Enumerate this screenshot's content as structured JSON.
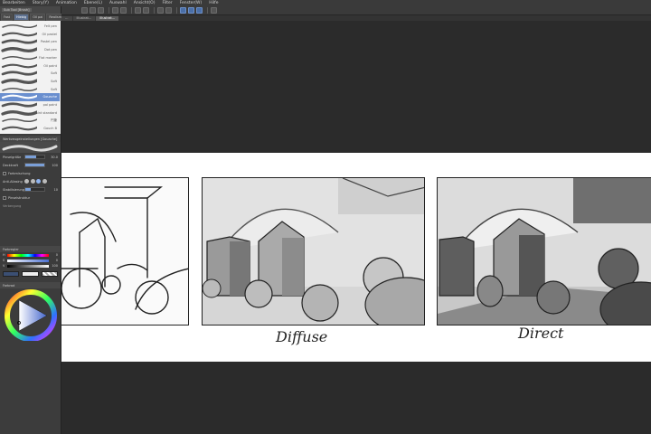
{
  "menu": [
    "Bearbeiten",
    "Story(Y)",
    "Animation",
    "Ebene(L)",
    "Auswahl",
    "Ansicht(O)",
    "Filter",
    "Fenster(W)",
    "Hilfe"
  ],
  "tabs": [
    {
      "label": "…",
      "active": false
    },
    {
      "label": "Illustrat…",
      "active": false
    },
    {
      "label": "Illustrat…",
      "active": true
    }
  ],
  "left_panel": {
    "sub_tool_tab": "Sub Tool [Brush]",
    "tool_tabs": [
      "Fast",
      "Hiebig",
      "Oil pai",
      "Realism",
      "Gouac"
    ],
    "brushes": [
      {
        "label": "Felt pen",
        "active": false
      },
      {
        "label": "Oil pastel",
        "active": false
      },
      {
        "label": "Pastel pen",
        "active": false
      },
      {
        "label": "Dot pen",
        "active": false
      },
      {
        "label": "Flat marker",
        "active": false
      },
      {
        "label": "Oil paint",
        "active": false
      },
      {
        "label": "Soft",
        "active": false
      },
      {
        "label": "Soft",
        "active": false
      },
      {
        "label": "Soft",
        "active": false
      },
      {
        "label": "Gouache",
        "active": true
      },
      {
        "label": "pal paint",
        "active": false
      },
      {
        "label": "paint standard",
        "active": false
      },
      {
        "label": "円筆",
        "active": false
      },
      {
        "label": "Gouch B",
        "active": false
      }
    ],
    "tool_property_title": "Werkzeugeinstellungen [Gouache]",
    "properties": {
      "brush_size_label": "Pinselgröße",
      "brush_size_value": "30.0",
      "brush_size_fill": 0.55,
      "opacity_label": "Deckkraft",
      "opacity_value": "100",
      "opacity_fill": 1.0,
      "color_mix_label": "Farbmischung",
      "antialias_label": "Anti-Aliasing",
      "antialias_level": 3,
      "stabilization_label": "Stabilisierung",
      "stabilization_value": "10",
      "stabilization_fill": 0.3,
      "brush_tip_label": "Pinselstruktur",
      "brush_tip_sub": "Verbergung"
    },
    "color_panel": {
      "title": "Farbregler",
      "rows": [
        {
          "label": "H",
          "value": "0"
        },
        {
          "label": "S",
          "value": "0"
        },
        {
          "label": "V",
          "value": "100"
        }
      ]
    },
    "wheel_title": "Farbrad"
  },
  "canvas": {
    "captions": [
      "Diffuse",
      "Direct"
    ]
  },
  "colors": {
    "panel_bg": "#3c3c3c",
    "canvas_bg": "#2b2b2b",
    "accent": "#6a8fcf",
    "paper": "#ffffff"
  }
}
